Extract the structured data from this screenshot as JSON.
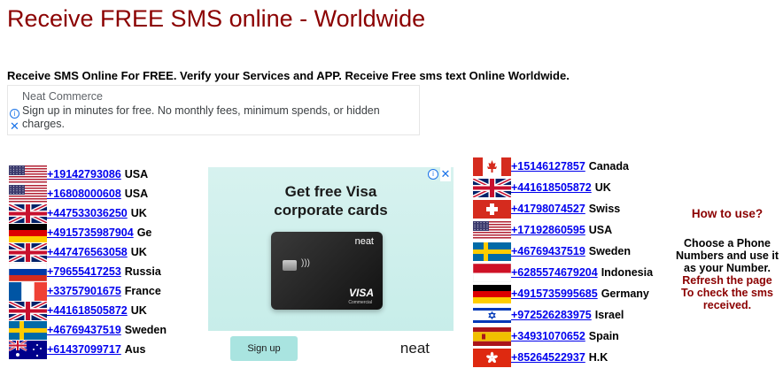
{
  "page": {
    "title": "Receive FREE SMS online - Worldwide",
    "intro": "Receive SMS Online For FREE. Verify your Services and APP. Receive Free sms text Online Worldwide."
  },
  "ad_top": {
    "brand": "Neat Commerce",
    "body": "Sign up in minutes for free. No monthly fees, minimum spends, or hidden charges."
  },
  "ad_mid": {
    "headline": "Get free Visa corporate cards",
    "card_brand": "neat",
    "card_network": "VISA",
    "card_sub": "Commercial",
    "button": "Sign up",
    "logo": "neat"
  },
  "numbers_left": [
    {
      "flag": "us",
      "number": "+19142793086",
      "country": "USA"
    },
    {
      "flag": "us",
      "number": "+16808000608",
      "country": "USA"
    },
    {
      "flag": "uk",
      "number": "+447533036250",
      "country": "UK"
    },
    {
      "flag": "de",
      "number": "+4915735987904",
      "country": "Ge"
    },
    {
      "flag": "uk",
      "number": "+447476563058",
      "country": "UK"
    },
    {
      "flag": "ru",
      "number": "+79655417253",
      "country": "Russia"
    },
    {
      "flag": "fr",
      "number": "+33757901675",
      "country": "France"
    },
    {
      "flag": "uk",
      "number": "+441618505872",
      "country": "UK"
    },
    {
      "flag": "se",
      "number": "+46769437519",
      "country": "Sweden"
    },
    {
      "flag": "au",
      "number": "+61437099717",
      "country": "Aus"
    }
  ],
  "numbers_mid": [
    {
      "flag": "ca",
      "number": "+15146127857",
      "country": "Canada"
    },
    {
      "flag": "uk",
      "number": "+441618505872",
      "country": "UK"
    },
    {
      "flag": "ch",
      "number": "+41798074527",
      "country": "Swiss"
    },
    {
      "flag": "us",
      "number": "+17192860595",
      "country": "USA"
    },
    {
      "flag": "se",
      "number": "+46769437519",
      "country": "Sweden"
    },
    {
      "flag": "id",
      "number": "+6285574679204",
      "country": "Indonesia"
    },
    {
      "flag": "de",
      "number": "+4915735995685",
      "country": "Germany"
    },
    {
      "flag": "il",
      "number": "+972526283975",
      "country": "Israel"
    },
    {
      "flag": "es",
      "number": "+34931070652",
      "country": "Spain"
    },
    {
      "flag": "hk",
      "number": "+85264522937",
      "country": "H.K"
    }
  ],
  "sidebar": {
    "how_to": "How to use?",
    "instructions": "Choose a Phone Numbers and use it as your Number.",
    "refresh": "Refresh the page To check the sms received."
  },
  "colors": {
    "title": "#8b0000",
    "link": "#0000ee"
  }
}
